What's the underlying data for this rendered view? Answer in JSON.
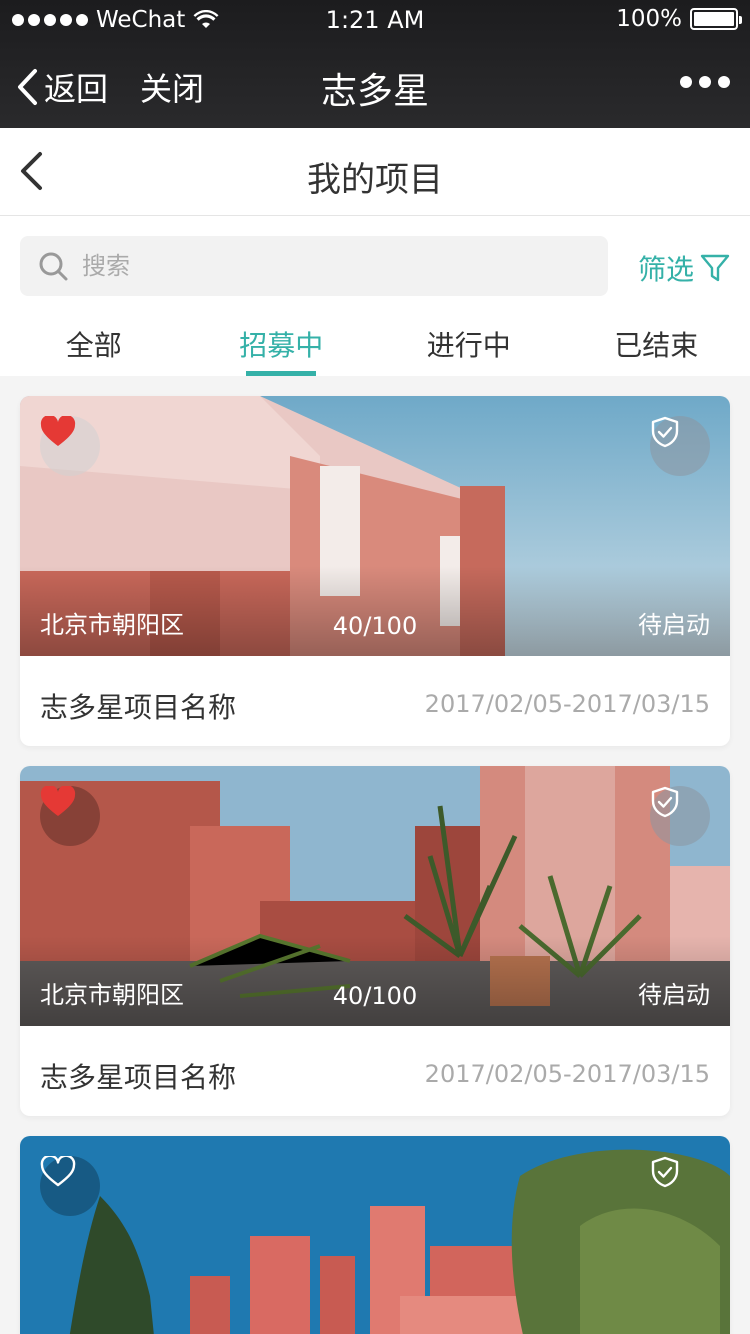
{
  "status_bar": {
    "carrier": "WeChat",
    "time": "1:21 AM",
    "battery": "100%",
    "battery_level": 1.0
  },
  "wechat_nav": {
    "back_label": "返回",
    "close_label": "关闭",
    "title": "志多星"
  },
  "page": {
    "title": "我的项目"
  },
  "search": {
    "placeholder": "搜索",
    "value": ""
  },
  "filter": {
    "label": "筛选"
  },
  "tabs": [
    {
      "label": "全部",
      "active": false
    },
    {
      "label": "招募中",
      "active": true
    },
    {
      "label": "进行中",
      "active": false
    },
    {
      "label": "已结束",
      "active": false
    }
  ],
  "projects": [
    {
      "favorited": true,
      "location": "北京市朝阳区",
      "count": "40/100",
      "status": "待启动",
      "name": "志多星项目名称",
      "date": "2017/02/05-2017/03/15"
    },
    {
      "favorited": true,
      "location": "北京市朝阳区",
      "count": "40/100",
      "status": "待启动",
      "name": "志多星项目名称",
      "date": "2017/02/05-2017/03/15"
    },
    {
      "favorited": false,
      "location": "",
      "count": "",
      "status": "",
      "name": "",
      "date": ""
    }
  ],
  "colors": {
    "accent": "#35b1a8",
    "heart": "#e53935",
    "nav_bg": "#1c1c1e"
  }
}
